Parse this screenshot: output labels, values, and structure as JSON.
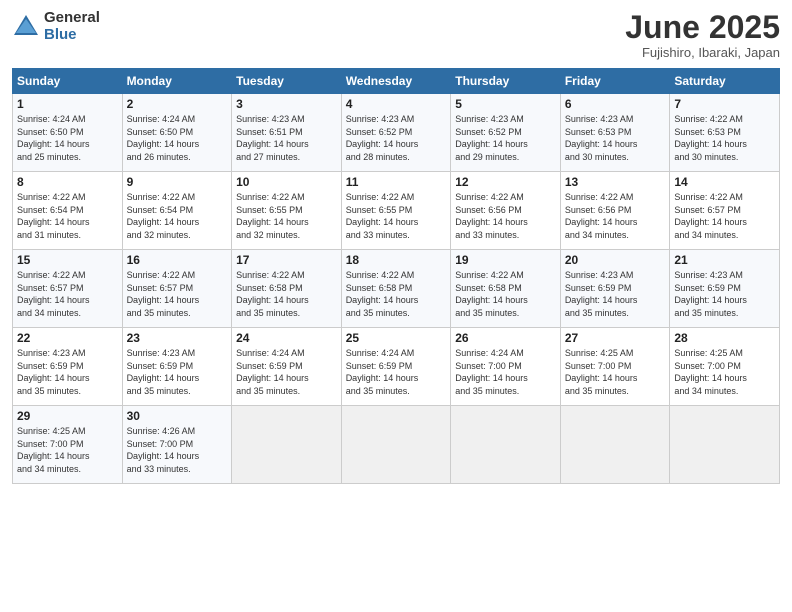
{
  "header": {
    "logo_general": "General",
    "logo_blue": "Blue",
    "title": "June 2025",
    "location": "Fujishiro, Ibaraki, Japan"
  },
  "days_of_week": [
    "Sunday",
    "Monday",
    "Tuesday",
    "Wednesday",
    "Thursday",
    "Friday",
    "Saturday"
  ],
  "weeks": [
    [
      {
        "day": "1",
        "info": "Sunrise: 4:24 AM\nSunset: 6:50 PM\nDaylight: 14 hours\nand 25 minutes."
      },
      {
        "day": "2",
        "info": "Sunrise: 4:24 AM\nSunset: 6:50 PM\nDaylight: 14 hours\nand 26 minutes."
      },
      {
        "day": "3",
        "info": "Sunrise: 4:23 AM\nSunset: 6:51 PM\nDaylight: 14 hours\nand 27 minutes."
      },
      {
        "day": "4",
        "info": "Sunrise: 4:23 AM\nSunset: 6:52 PM\nDaylight: 14 hours\nand 28 minutes."
      },
      {
        "day": "5",
        "info": "Sunrise: 4:23 AM\nSunset: 6:52 PM\nDaylight: 14 hours\nand 29 minutes."
      },
      {
        "day": "6",
        "info": "Sunrise: 4:23 AM\nSunset: 6:53 PM\nDaylight: 14 hours\nand 30 minutes."
      },
      {
        "day": "7",
        "info": "Sunrise: 4:22 AM\nSunset: 6:53 PM\nDaylight: 14 hours\nand 30 minutes."
      }
    ],
    [
      {
        "day": "8",
        "info": "Sunrise: 4:22 AM\nSunset: 6:54 PM\nDaylight: 14 hours\nand 31 minutes."
      },
      {
        "day": "9",
        "info": "Sunrise: 4:22 AM\nSunset: 6:54 PM\nDaylight: 14 hours\nand 32 minutes."
      },
      {
        "day": "10",
        "info": "Sunrise: 4:22 AM\nSunset: 6:55 PM\nDaylight: 14 hours\nand 32 minutes."
      },
      {
        "day": "11",
        "info": "Sunrise: 4:22 AM\nSunset: 6:55 PM\nDaylight: 14 hours\nand 33 minutes."
      },
      {
        "day": "12",
        "info": "Sunrise: 4:22 AM\nSunset: 6:56 PM\nDaylight: 14 hours\nand 33 minutes."
      },
      {
        "day": "13",
        "info": "Sunrise: 4:22 AM\nSunset: 6:56 PM\nDaylight: 14 hours\nand 34 minutes."
      },
      {
        "day": "14",
        "info": "Sunrise: 4:22 AM\nSunset: 6:57 PM\nDaylight: 14 hours\nand 34 minutes."
      }
    ],
    [
      {
        "day": "15",
        "info": "Sunrise: 4:22 AM\nSunset: 6:57 PM\nDaylight: 14 hours\nand 34 minutes."
      },
      {
        "day": "16",
        "info": "Sunrise: 4:22 AM\nSunset: 6:57 PM\nDaylight: 14 hours\nand 35 minutes."
      },
      {
        "day": "17",
        "info": "Sunrise: 4:22 AM\nSunset: 6:58 PM\nDaylight: 14 hours\nand 35 minutes."
      },
      {
        "day": "18",
        "info": "Sunrise: 4:22 AM\nSunset: 6:58 PM\nDaylight: 14 hours\nand 35 minutes."
      },
      {
        "day": "19",
        "info": "Sunrise: 4:22 AM\nSunset: 6:58 PM\nDaylight: 14 hours\nand 35 minutes."
      },
      {
        "day": "20",
        "info": "Sunrise: 4:23 AM\nSunset: 6:59 PM\nDaylight: 14 hours\nand 35 minutes."
      },
      {
        "day": "21",
        "info": "Sunrise: 4:23 AM\nSunset: 6:59 PM\nDaylight: 14 hours\nand 35 minutes."
      }
    ],
    [
      {
        "day": "22",
        "info": "Sunrise: 4:23 AM\nSunset: 6:59 PM\nDaylight: 14 hours\nand 35 minutes."
      },
      {
        "day": "23",
        "info": "Sunrise: 4:23 AM\nSunset: 6:59 PM\nDaylight: 14 hours\nand 35 minutes."
      },
      {
        "day": "24",
        "info": "Sunrise: 4:24 AM\nSunset: 6:59 PM\nDaylight: 14 hours\nand 35 minutes."
      },
      {
        "day": "25",
        "info": "Sunrise: 4:24 AM\nSunset: 6:59 PM\nDaylight: 14 hours\nand 35 minutes."
      },
      {
        "day": "26",
        "info": "Sunrise: 4:24 AM\nSunset: 7:00 PM\nDaylight: 14 hours\nand 35 minutes."
      },
      {
        "day": "27",
        "info": "Sunrise: 4:25 AM\nSunset: 7:00 PM\nDaylight: 14 hours\nand 35 minutes."
      },
      {
        "day": "28",
        "info": "Sunrise: 4:25 AM\nSunset: 7:00 PM\nDaylight: 14 hours\nand 34 minutes."
      }
    ],
    [
      {
        "day": "29",
        "info": "Sunrise: 4:25 AM\nSunset: 7:00 PM\nDaylight: 14 hours\nand 34 minutes."
      },
      {
        "day": "30",
        "info": "Sunrise: 4:26 AM\nSunset: 7:00 PM\nDaylight: 14 hours\nand 33 minutes."
      },
      {
        "day": "",
        "info": ""
      },
      {
        "day": "",
        "info": ""
      },
      {
        "day": "",
        "info": ""
      },
      {
        "day": "",
        "info": ""
      },
      {
        "day": "",
        "info": ""
      }
    ]
  ]
}
